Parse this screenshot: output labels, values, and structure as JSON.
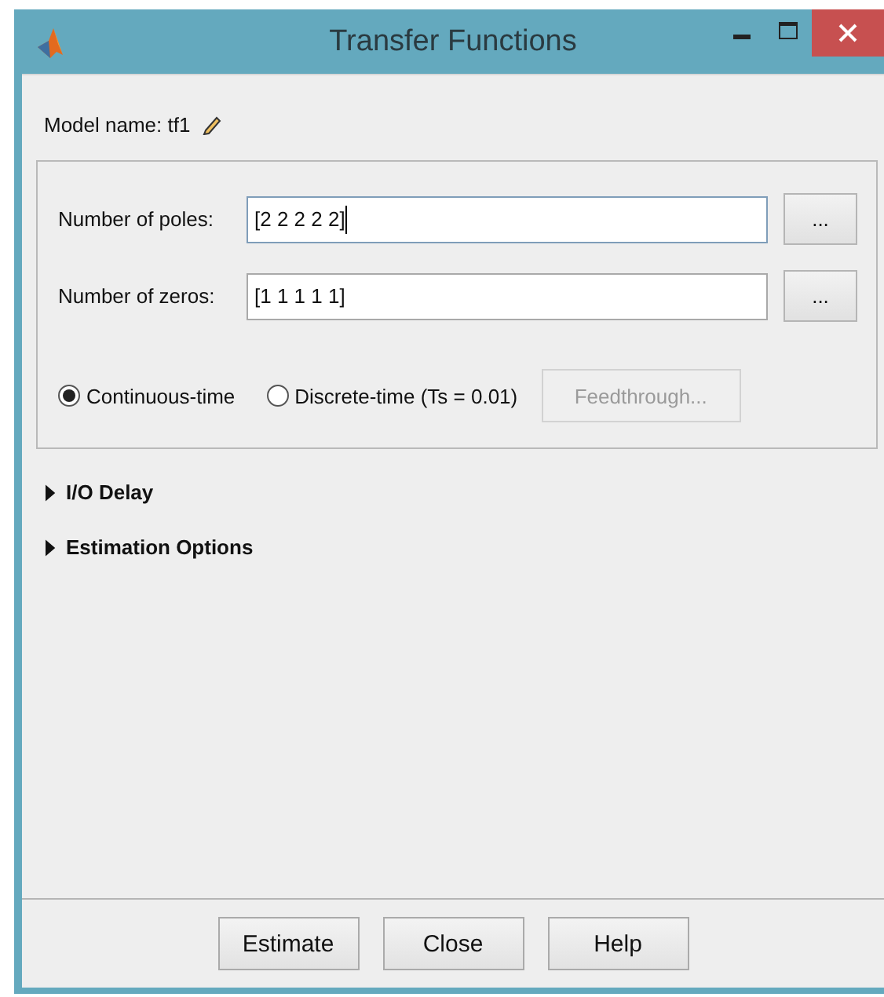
{
  "window": {
    "title": "Transfer Functions"
  },
  "model_name": {
    "label": "Model name: tf1"
  },
  "fields": [
    {
      "label": "Number of poles:",
      "value": "[2 2 2 2 2]",
      "focused": true,
      "button": "..."
    },
    {
      "label": "Number of zeros:",
      "value": "[1 1 1 1 1]",
      "focused": false,
      "button": "..."
    }
  ],
  "radios": [
    {
      "label": "Continuous-time",
      "selected": true
    },
    {
      "label": "Discrete-time (Ts = 0.01)",
      "selected": false
    }
  ],
  "feedthrough": {
    "label": "Feedthrough...",
    "disabled": true
  },
  "sections": [
    {
      "label": "I/O Delay",
      "expanded": false
    },
    {
      "label": "Estimation Options",
      "expanded": false
    }
  ],
  "buttons": [
    "Estimate",
    "Close",
    "Help"
  ]
}
